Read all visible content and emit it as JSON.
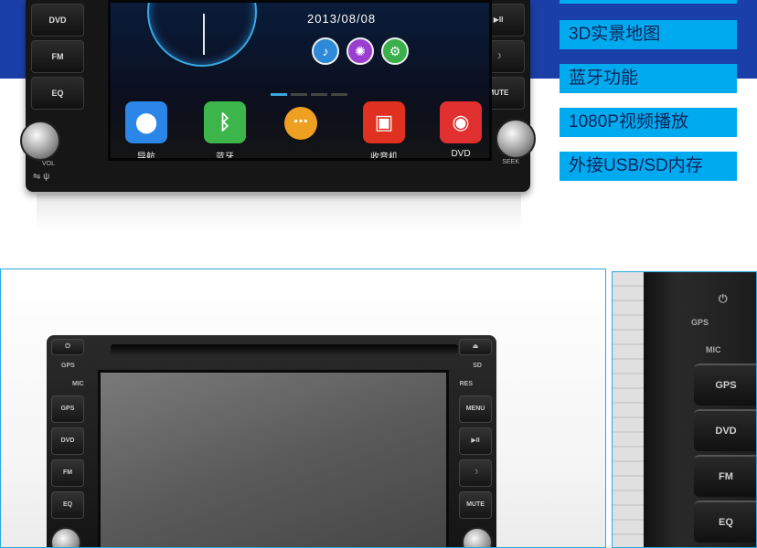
{
  "top": {
    "left_buttons": [
      "DVD",
      "FM",
      "EQ"
    ],
    "right_buttons": [
      "▶II",
      "☽",
      "MUTE"
    ],
    "vol_label": "VOL",
    "seek_label": "SEEK",
    "date": "2013/08/08",
    "apps": [
      {
        "label": "导航",
        "icon": "map-pin-icon",
        "color": "#2b86e8",
        "glyph": "⬤"
      },
      {
        "label": "蓝牙",
        "icon": "bluetooth-icon",
        "color": "#3cb64a",
        "glyph": "ᛒ"
      },
      {
        "label": "",
        "icon": "apps-grid-icon",
        "color": "#f0a020",
        "glyph": "⋯"
      },
      {
        "label": "收音机",
        "icon": "radio-icon",
        "color": "#e03020",
        "glyph": "▣"
      },
      {
        "label": "DVD",
        "icon": "disc-icon",
        "color": "#e03030",
        "glyph": "◉"
      }
    ],
    "features": [
      "3D实景地图",
      "蓝牙功能",
      "1080P视频播放",
      "外接USB/SD内存"
    ]
  },
  "front": {
    "left_buttons": [
      "GPS",
      "DVD",
      "FM",
      "EQ"
    ],
    "right_buttons": [
      "MENU",
      "▶II",
      "☽",
      "MUTE"
    ],
    "gps_label": "GPS",
    "mic_label": "MIC",
    "sd_label": "SD",
    "res_label": "RES"
  },
  "side": {
    "gps_label": "GPS",
    "mic_label": "MIC",
    "buttons": [
      "GPS",
      "DVD",
      "FM",
      "EQ"
    ]
  }
}
